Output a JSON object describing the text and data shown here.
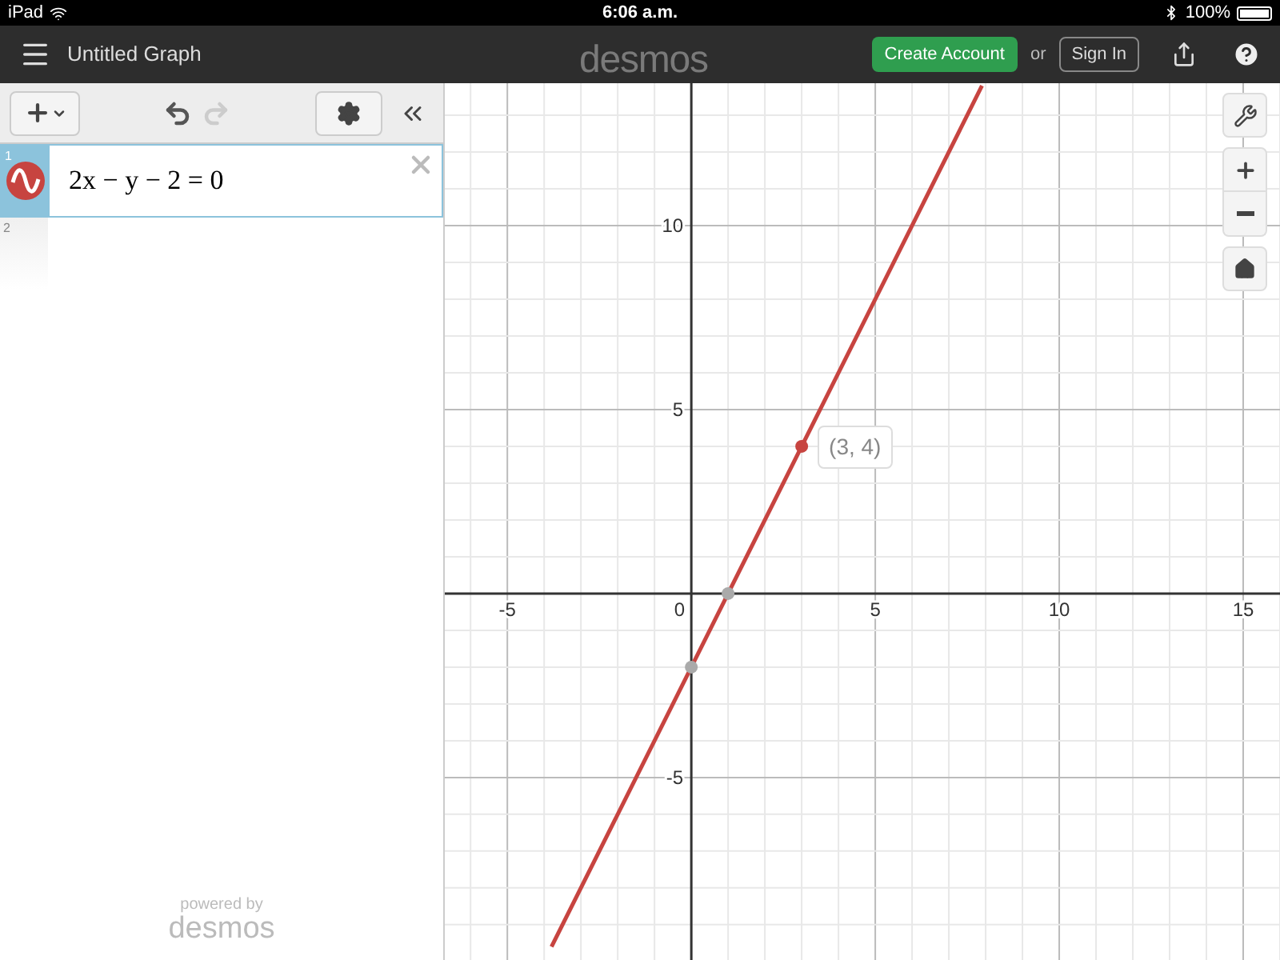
{
  "status_bar": {
    "device": "iPad",
    "time": "6:06 a.m.",
    "battery": "100%"
  },
  "header": {
    "title": "Untitled Graph",
    "logo": "desmos",
    "create_account": "Create Account",
    "or": "or",
    "sign_in": "Sign In"
  },
  "expressions": [
    {
      "number": "1",
      "latex": "2x − y − 2 = 0",
      "color": "#c74440",
      "selected": true
    },
    {
      "number": "2",
      "selected": false
    }
  ],
  "footer": {
    "powered_by": "powered by",
    "logo": "desmos"
  },
  "graph": {
    "origin_label": "0",
    "chart_data": {
      "type": "line",
      "xlim": [
        -6.7,
        16
      ],
      "ylim": [
        -9.96,
        13.87
      ],
      "xticks": [
        -5,
        5,
        10,
        15
      ],
      "yticks": [
        -5,
        5,
        10
      ],
      "x": [
        -3.8,
        7.9
      ],
      "series": [
        {
          "color": "#c74440",
          "values": [
            -9.6,
            13.8
          ]
        }
      ],
      "grid": true,
      "annotations": [
        {
          "x": 3,
          "y": 4,
          "text": "(3, 4)"
        }
      ]
    }
  }
}
